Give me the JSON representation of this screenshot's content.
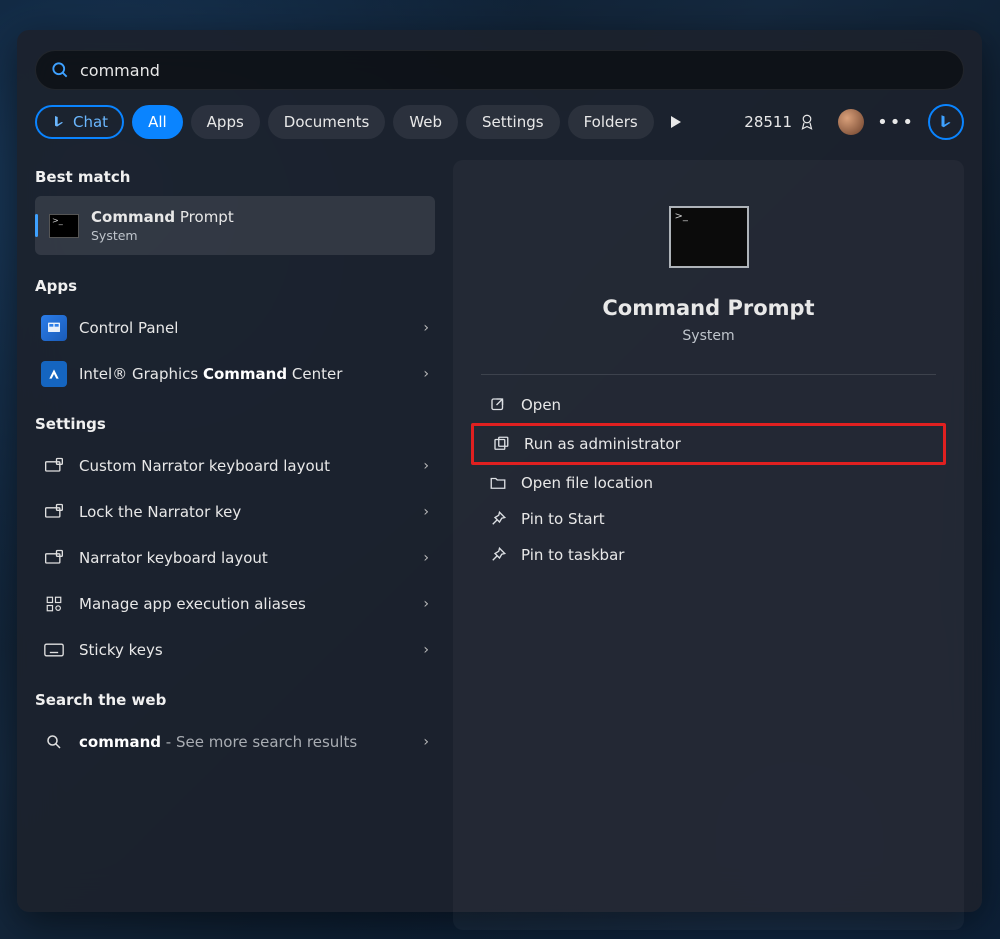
{
  "search": {
    "value": "command"
  },
  "filters": {
    "chat": "Chat",
    "all": "All",
    "apps": "Apps",
    "documents": "Documents",
    "web": "Web",
    "settings": "Settings",
    "folders": "Folders"
  },
  "rewards": {
    "points": "28511"
  },
  "sections": {
    "best_match": "Best match",
    "apps": "Apps",
    "settings": "Settings",
    "search_web": "Search the web"
  },
  "best_match_item": {
    "title_bold": "Command",
    "title_rest": " Prompt",
    "subtitle": "System"
  },
  "apps_items": [
    {
      "label": "Control Panel"
    },
    {
      "label_prefix": "Intel® Graphics ",
      "label_bold": "Command",
      "label_suffix": " Center"
    }
  ],
  "settings_items": [
    {
      "label": "Custom Narrator keyboard layout"
    },
    {
      "label": "Lock the Narrator key"
    },
    {
      "label": "Narrator keyboard layout"
    },
    {
      "label": "Manage app execution aliases"
    },
    {
      "label": "Sticky keys"
    }
  ],
  "web_search": {
    "term": "command",
    "suffix": " - See more search results"
  },
  "preview": {
    "title": "Command Prompt",
    "subtitle": "System"
  },
  "actions": {
    "open": "Open",
    "run_admin": "Run as administrator",
    "open_location": "Open file location",
    "pin_start": "Pin to Start",
    "pin_taskbar": "Pin to taskbar"
  }
}
